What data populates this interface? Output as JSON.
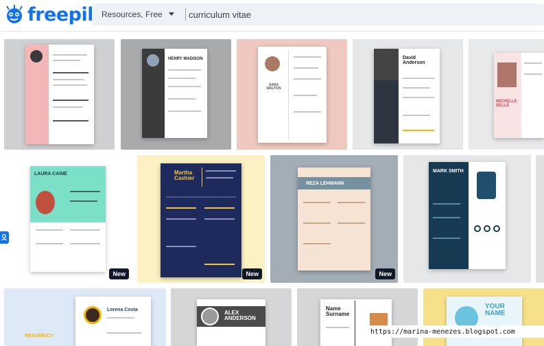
{
  "brand": {
    "name": "freepik",
    "color": "#1273eb"
  },
  "search": {
    "filter_label": "Resources, Free",
    "query": "curriculum vitae"
  },
  "badges": {
    "new": "New"
  },
  "tiles": {
    "t2": {
      "name": "HENRY MADISON"
    },
    "t3": {
      "name": "SARA WALTON"
    },
    "t4": {
      "name": "David Anderson"
    },
    "t5": {
      "name": "MICHELLE BELLE"
    },
    "t6": {
      "name": "LAURA CAINE"
    },
    "t7": {
      "name": "Martha Cashier"
    },
    "t8": {
      "name": "REZA LEHMANN"
    },
    "t9": {
      "name": "MARK SMITH"
    },
    "t10": {
      "name": "Lorena Costa",
      "tag": "RESUME/CV"
    },
    "t11": {
      "name": "ALEX ANDERSON"
    },
    "t12": {
      "name": "Name Surname"
    },
    "t13": {
      "name": "YOUR NAME"
    }
  },
  "watermark": "https://marina-menezes.blogspot.com"
}
